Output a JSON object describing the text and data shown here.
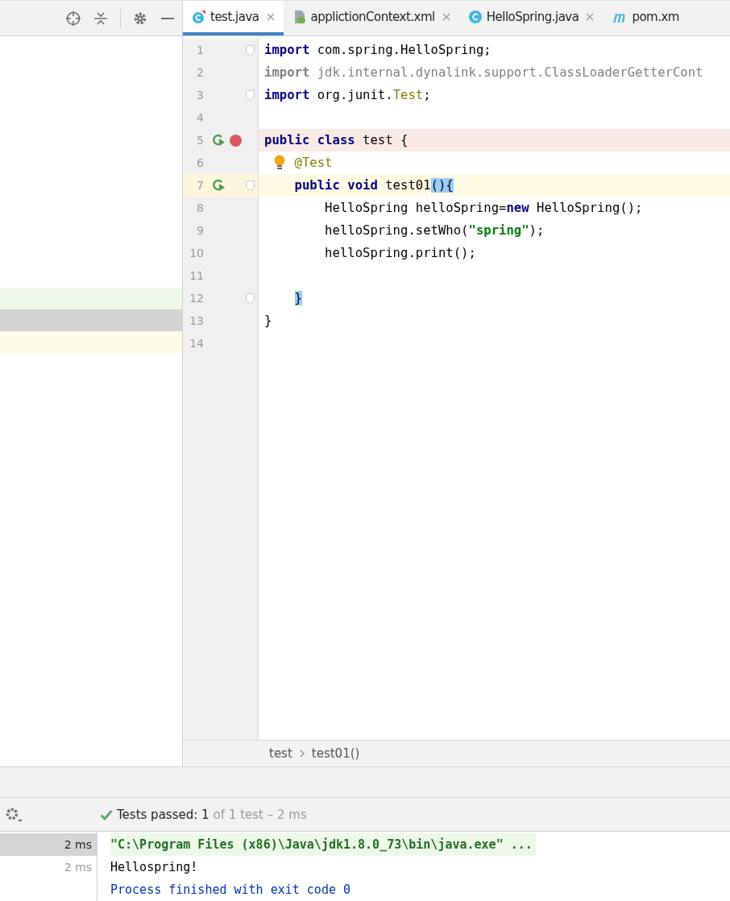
{
  "tabs": [
    {
      "label": "test.java",
      "kind": "java-test",
      "selected": true,
      "closable": true
    },
    {
      "label": "applictionContext.xml",
      "kind": "xml",
      "selected": false,
      "closable": true
    },
    {
      "label": "HelloSpring.java",
      "kind": "java-class",
      "selected": false,
      "closable": true
    },
    {
      "label": "pom.xm",
      "kind": "maven",
      "selected": false,
      "closable": false
    }
  ],
  "project_panel": {
    "rows": [
      {
        "color": "#edf8e9"
      },
      {
        "color": "#d3d3d3"
      },
      {
        "color": "#fefbe6"
      }
    ]
  },
  "editor": {
    "lines": [
      {
        "number": "1",
        "fold": true,
        "run_icon": false,
        "breakpoint": false,
        "bulb": false,
        "current": false,
        "tokens": [
          {
            "kind": "keyword",
            "text": "import"
          },
          {
            "kind": "plain",
            "text": " com.spring.HelloSpring;"
          }
        ]
      },
      {
        "number": "2",
        "fold": false,
        "run_icon": false,
        "breakpoint": false,
        "bulb": false,
        "current": false,
        "tokens": [
          {
            "kind": "unused-keyword",
            "text": "import"
          },
          {
            "kind": "unused",
            "text": " jdk.internal.dynalink.support.ClassLoaderGetterCont"
          }
        ]
      },
      {
        "number": "3",
        "fold": true,
        "run_icon": false,
        "breakpoint": false,
        "bulb": false,
        "current": false,
        "tokens": [
          {
            "kind": "keyword",
            "text": "import"
          },
          {
            "kind": "plain",
            "text": " org.junit."
          },
          {
            "kind": "classref",
            "text": "Test"
          },
          {
            "kind": "plain",
            "text": ";"
          }
        ]
      },
      {
        "number": "4",
        "fold": false,
        "run_icon": false,
        "breakpoint": false,
        "bulb": false,
        "current": false
      },
      {
        "number": "5",
        "fold": false,
        "run_icon": true,
        "breakpoint": true,
        "bulb": false,
        "current": false,
        "tokens": [
          {
            "kind": "keyword",
            "text": "public class"
          },
          {
            "kind": "plain",
            "text": " test {"
          }
        ]
      },
      {
        "number": "6",
        "fold": false,
        "run_icon": false,
        "breakpoint": false,
        "bulb": true,
        "current": false,
        "tokens": [
          {
            "kind": "annotation",
            "text": "    @Test"
          }
        ]
      },
      {
        "number": "7",
        "fold": true,
        "run_icon": true,
        "breakpoint": false,
        "bulb": false,
        "current": true,
        "tokens": [
          {
            "kind": "keyword",
            "text": "    public void"
          },
          {
            "kind": "plain",
            "text": " test01"
          },
          {
            "kind": "matched",
            "text": "(){"
          }
        ]
      },
      {
        "number": "8",
        "fold": false,
        "run_icon": false,
        "breakpoint": false,
        "bulb": false,
        "current": false,
        "tokens": [
          {
            "kind": "plain",
            "text": "        HelloSpring helloSpring="
          },
          {
            "kind": "keyword",
            "text": "new"
          },
          {
            "kind": "plain",
            "text": " HelloSpring();"
          }
        ]
      },
      {
        "number": "9",
        "fold": false,
        "run_icon": false,
        "breakpoint": false,
        "bulb": false,
        "current": false,
        "tokens": [
          {
            "kind": "plain",
            "text": "        helloSpring.setWho("
          },
          {
            "kind": "string",
            "text": "\"spring\""
          },
          {
            "kind": "plain",
            "text": ");"
          }
        ]
      },
      {
        "number": "10",
        "fold": false,
        "run_icon": false,
        "breakpoint": false,
        "bulb": false,
        "current": false,
        "tokens": [
          {
            "kind": "plain",
            "text": "        helloSpring.print();"
          }
        ]
      },
      {
        "number": "11",
        "fold": false,
        "run_icon": false,
        "breakpoint": false,
        "bulb": false,
        "current": false
      },
      {
        "number": "12",
        "fold": true,
        "run_icon": false,
        "breakpoint": false,
        "bulb": false,
        "current": false,
        "tokens": [
          {
            "kind": "matched",
            "text": "    }"
          }
        ]
      },
      {
        "number": "13",
        "fold": false,
        "run_icon": false,
        "breakpoint": false,
        "bulb": false,
        "current": false,
        "tokens": [
          {
            "kind": "plain",
            "text": "}"
          }
        ]
      },
      {
        "number": "14",
        "fold": false,
        "run_icon": false,
        "breakpoint": false,
        "bulb": false,
        "current": false
      }
    ]
  },
  "breadcrumbs": [
    "test",
    "test01()"
  ],
  "run_panel": {
    "status": {
      "label": "Tests passed:",
      "count": "1",
      "detail": "of 1 test – 2 ms"
    },
    "test_rows": [
      {
        "time": "2 ms",
        "selected": true
      },
      {
        "time": "2 ms",
        "selected": false
      }
    ],
    "output": [
      {
        "kind": "command",
        "text": "\"C:\\Program Files (x86)\\Java\\jdk1.8.0_73\\bin\\java.exe\" ..."
      },
      {
        "kind": "stdout",
        "text": "Hellospring!"
      },
      {
        "kind": "system",
        "text": "Process finished with exit code 0"
      }
    ]
  }
}
